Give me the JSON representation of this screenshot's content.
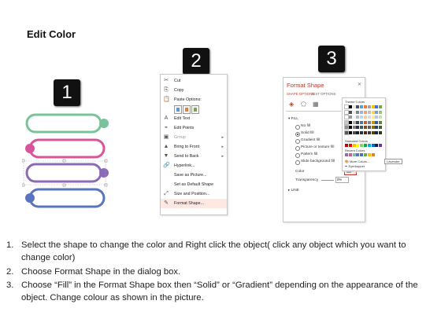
{
  "title": "Edit Color",
  "steps": [
    {
      "number": "1"
    },
    {
      "number": "2"
    },
    {
      "number": "3"
    }
  ],
  "shapes": {
    "colors": [
      "#79c39a",
      "#d9559b",
      "#8c6bb6",
      "#5a74bf"
    ]
  },
  "context_menu": {
    "items": [
      {
        "label": "Cut",
        "icon": "scissors-icon",
        "glyph": "✂"
      },
      {
        "label": "Copy",
        "icon": "copy-icon",
        "glyph": "⎘"
      },
      {
        "label": "Paste Options:",
        "icon": "paste-icon",
        "glyph": "📋"
      },
      {
        "label": "",
        "icon": "paste-options-icons",
        "glyph": ""
      },
      {
        "label": "Edit Text",
        "icon": "edit-text-icon",
        "glyph": "A"
      },
      {
        "label": "Edit Points",
        "icon": "edit-points-icon",
        "glyph": "⌖"
      },
      {
        "label": "Group",
        "icon": "group-icon",
        "glyph": "▣"
      },
      {
        "label": "Bring to Front",
        "icon": "bring-front-icon",
        "glyph": "▲"
      },
      {
        "label": "Send to Back",
        "icon": "send-back-icon",
        "glyph": "▼"
      },
      {
        "label": "Hyperlink...",
        "icon": "hyperlink-icon",
        "glyph": "🔗"
      },
      {
        "label": "Save as Picture...",
        "icon": "",
        "glyph": ""
      },
      {
        "label": "Set as Default Shape",
        "icon": "",
        "glyph": ""
      },
      {
        "label": "Size and Position...",
        "icon": "size-position-icon",
        "glyph": "⤢"
      },
      {
        "label": "Format Shape...",
        "icon": "format-shape-icon",
        "glyph": "✎"
      }
    ]
  },
  "format_shape": {
    "title": "Format Shape",
    "tabs": [
      "SHAPE OPTIONS",
      "TEXT OPTIONS"
    ],
    "fill_section": "FILL",
    "fill_options": [
      "No fill",
      "Solid fill",
      "Gradient fill",
      "Picture or texture fill",
      "Pattern fill",
      "Slide background fill"
    ],
    "selected_fill": "Solid fill",
    "color_label": "Color",
    "transparency_label": "Transparency",
    "transparency_value": "0%",
    "line_section": "LINE",
    "color_picker": {
      "theme_colors_label": "Theme Colors",
      "standard_colors_label": "Standard Colors",
      "recent_colors_label": "Recent Colors",
      "more_colors": "More Colors...",
      "eyedropper": "Eyedropper",
      "tooltip": "Lavender",
      "theme_row": [
        "#ffffff",
        "#000000",
        "#e7e6e6",
        "#44546a",
        "#5b9bd5",
        "#ed7d31",
        "#a5a5a5",
        "#ffc000",
        "#4472c4",
        "#70ad47"
      ],
      "standard_row": [
        "#c00000",
        "#ff0000",
        "#ffc000",
        "#ffff00",
        "#92d050",
        "#00b050",
        "#00b0f0",
        "#0070c0",
        "#002060",
        "#7030a0"
      ],
      "recent_row": [
        "#8c6bb6",
        "#d9559b",
        "#79c39a",
        "#5a74bf",
        "#4472c4",
        "#70ad47",
        "#ffc000",
        "#ed7d31"
      ]
    }
  },
  "instructions": [
    {
      "num": "1.",
      "text": "Select the shape to change the color and Right click the object( click any object which you want to change color)"
    },
    {
      "num": "2.",
      "text": "Choose Format Shape in the dialog box."
    },
    {
      "num": "3.",
      "text": "Choose “Fill” in the Format Shape box then “Solid” or “Gradient” depending on the appearance of the object. Change colour as shown in the picture."
    }
  ]
}
